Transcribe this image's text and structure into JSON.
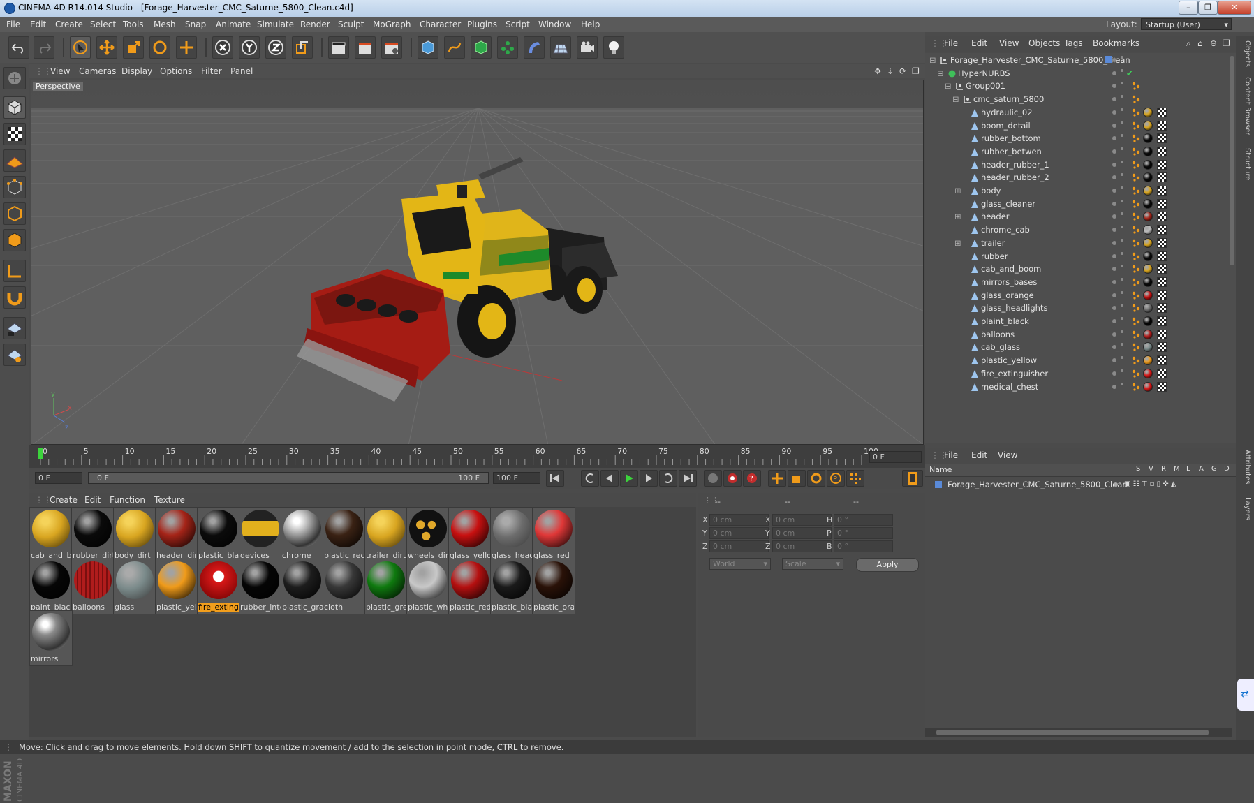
{
  "window": {
    "title": "CINEMA 4D R14.014 Studio - [Forage_Harvester_CMC_Saturne_5800_Clean.c4d]",
    "controls": [
      "–",
      "❐",
      "✕"
    ]
  },
  "menubar": {
    "items": [
      "File",
      "Edit",
      "Create",
      "Select",
      "Tools",
      "Mesh",
      "Snap",
      "Animate",
      "Simulate",
      "Render",
      "Sculpt",
      "MoGraph",
      "Character",
      "Plugins",
      "Script",
      "Window",
      "Help"
    ],
    "layout_label": "Layout:",
    "layout_value": "Startup (User)"
  },
  "viewport": {
    "menu": [
      "View",
      "Cameras",
      "Display",
      "Options",
      "Filter",
      "Panel"
    ],
    "label": "Perspective"
  },
  "timeline": {
    "ticks": [
      "0",
      "5",
      "10",
      "15",
      "20",
      "25",
      "30",
      "35",
      "40",
      "45",
      "50",
      "55",
      "60",
      "65",
      "70",
      "75",
      "80",
      "85",
      "90",
      "95",
      "100"
    ],
    "current_frame": "0 F",
    "start_field": "0 F",
    "range_start": "0 F",
    "range_end": "100 F",
    "end_field": "100 F"
  },
  "materials": {
    "menu": [
      "Create",
      "Edit",
      "Function",
      "Texture"
    ],
    "items": [
      {
        "label": "cab_and_b",
        "color": "#d8a520",
        "style": "yellow-dark"
      },
      {
        "label": "rubber_dirt",
        "color": "#0a0a0a",
        "style": "black"
      },
      {
        "label": "body_dirt_(",
        "color": "#d8a520",
        "style": "yellow-dark"
      },
      {
        "label": "header_dir",
        "color": "#a52418",
        "style": "red"
      },
      {
        "label": "plastic_blac",
        "color": "#0b0b0b",
        "style": "black"
      },
      {
        "label": "devices",
        "color": "#e2b01d",
        "style": "yellow-stripe"
      },
      {
        "label": "chrome",
        "color": "#b9b9b9",
        "style": "chrome"
      },
      {
        "label": "plastic_red",
        "color": "#3a2214",
        "style": "dark-brown"
      },
      {
        "label": "trailer_dirt",
        "color": "#d8a520",
        "style": "yellow-dark"
      },
      {
        "label": "wheels_dir",
        "color": "#e0a82a",
        "style": "yellow-dots"
      },
      {
        "label": "glass_yello",
        "color": "#c81010",
        "style": "red-glossy"
      },
      {
        "label": "glass_head",
        "color": "#6c6c6c",
        "style": "glass"
      },
      {
        "label": "glass_red",
        "color": "#e03838",
        "style": "red-glossy"
      },
      {
        "label": "paint_black",
        "color": "#060606",
        "style": "black"
      },
      {
        "label": "balloons",
        "color": "#b01c1c",
        "style": "red-lines"
      },
      {
        "label": "glass",
        "color": "#7a8a8a",
        "style": "glass"
      },
      {
        "label": "plastic_yell",
        "color": "#f09b1a",
        "style": "orange"
      },
      {
        "label": "fire_exting",
        "color": "#d81818",
        "style": "fire"
      },
      {
        "label": "rubber_inte",
        "color": "#050505",
        "style": "black"
      },
      {
        "label": "plastic_gra",
        "color": "#1d1d1d",
        "style": "dark"
      },
      {
        "label": "cloth",
        "color": "#383838",
        "style": "dark"
      },
      {
        "label": "plastic_gre",
        "color": "#0f7a0f",
        "style": "green"
      },
      {
        "label": "plastic_whi",
        "color": "#c8c8c8",
        "style": "white"
      },
      {
        "label": "plastic_red",
        "color": "#b51010",
        "style": "red-glossy"
      },
      {
        "label": "plastic_blac",
        "color": "#1a1a1a",
        "style": "dark"
      },
      {
        "label": "plastic_ora",
        "color": "#2a1208",
        "style": "dark-brown"
      },
      {
        "label": "mirrors",
        "color": "#8a8a8a",
        "style": "chrome"
      }
    ],
    "selected_index": 17
  },
  "coordinates": {
    "header": [
      "--",
      "--",
      "--"
    ],
    "rows": [
      {
        "a": "X",
        "av": "0 cm",
        "b": "X",
        "bv": "0 cm",
        "c": "H",
        "cv": "0 °"
      },
      {
        "a": "Y",
        "av": "0 cm",
        "b": "Y",
        "bv": "0 cm",
        "c": "P",
        "cv": "0 °"
      },
      {
        "a": "Z",
        "av": "0 cm",
        "b": "Z",
        "bv": "0 cm",
        "c": "B",
        "cv": "0 °"
      }
    ],
    "mode": "World",
    "transform": "Scale",
    "apply": "Apply"
  },
  "object_manager": {
    "menu": [
      "File",
      "Edit",
      "View",
      "Objects",
      "Tags",
      "Bookmarks"
    ],
    "objects": [
      {
        "name": "Forage_Harvester_CMC_Saturne_5800_Clean",
        "depth": 0,
        "kind": "null",
        "tag": "none"
      },
      {
        "name": "HyperNURBS",
        "depth": 1,
        "kind": "nurbs",
        "tag": "check"
      },
      {
        "name": "Group001",
        "depth": 2,
        "kind": "null",
        "tag": "orange"
      },
      {
        "name": "cmc_saturn_5800",
        "depth": 3,
        "kind": "null",
        "tag": "orange"
      },
      {
        "name": "hydraulic_02",
        "depth": 4,
        "kind": "poly",
        "tag": "mat",
        "ball": "#d8a520"
      },
      {
        "name": "boom_detail",
        "depth": 4,
        "kind": "poly",
        "tag": "mat",
        "ball": "#d8a520"
      },
      {
        "name": "rubber_bottom",
        "depth": 4,
        "kind": "poly",
        "tag": "mat",
        "ball": "#0a0a0a"
      },
      {
        "name": "rubber_betwen",
        "depth": 4,
        "kind": "poly",
        "tag": "mat",
        "ball": "#0a0a0a"
      },
      {
        "name": "header_rubber_1",
        "depth": 4,
        "kind": "poly",
        "tag": "mat",
        "ball": "#0a0a0a"
      },
      {
        "name": "header_rubber_2",
        "depth": 4,
        "kind": "poly",
        "tag": "mat",
        "ball": "#0a0a0a"
      },
      {
        "name": "body",
        "depth": 4,
        "kind": "poly",
        "tag": "mat",
        "ball": "#d8a520",
        "expand": true
      },
      {
        "name": "glass_cleaner",
        "depth": 4,
        "kind": "poly",
        "tag": "mat",
        "ball": "#0a0a0a"
      },
      {
        "name": "header",
        "depth": 4,
        "kind": "poly",
        "tag": "mat",
        "ball": "#a52418",
        "expand": true
      },
      {
        "name": "chrome_cab",
        "depth": 4,
        "kind": "poly",
        "tag": "mat",
        "ball": "#bbbbbb"
      },
      {
        "name": "trailer",
        "depth": 4,
        "kind": "poly",
        "tag": "mat",
        "ball": "#d8a520",
        "expand": true
      },
      {
        "name": "rubber",
        "depth": 4,
        "kind": "poly",
        "tag": "mat",
        "ball": "#0a0a0a"
      },
      {
        "name": "cab_and_boom",
        "depth": 4,
        "kind": "poly",
        "tag": "mat",
        "ball": "#d8a520"
      },
      {
        "name": "mirrors_bases",
        "depth": 4,
        "kind": "poly",
        "tag": "mat",
        "ball": "#0a0a0a"
      },
      {
        "name": "glass_orange",
        "depth": 4,
        "kind": "poly",
        "tag": "mat",
        "ball": "#c81010"
      },
      {
        "name": "glass_headlights",
        "depth": 4,
        "kind": "poly",
        "tag": "mat",
        "ball": "#6c6c6c"
      },
      {
        "name": "plaint_black",
        "depth": 4,
        "kind": "poly",
        "tag": "mat",
        "ball": "#060606"
      },
      {
        "name": "balloons",
        "depth": 4,
        "kind": "poly",
        "tag": "mat",
        "ball": "#b01c1c"
      },
      {
        "name": "cab_glass",
        "depth": 4,
        "kind": "poly",
        "tag": "mat",
        "ball": "#7a8a8a"
      },
      {
        "name": "plastic_yellow",
        "depth": 4,
        "kind": "poly",
        "tag": "mat",
        "ball": "#f09b1a"
      },
      {
        "name": "fire_extinguisher",
        "depth": 4,
        "kind": "poly",
        "tag": "mat",
        "ball": "#d81818"
      },
      {
        "name": "medical_chest",
        "depth": 4,
        "kind": "poly",
        "tag": "mat",
        "ball": "#d81818"
      }
    ]
  },
  "layer_manager": {
    "menu": [
      "File",
      "Edit",
      "View"
    ],
    "columns": [
      "Name",
      "S",
      "V",
      "R",
      "M",
      "L",
      "A",
      "G",
      "D"
    ],
    "row": "Forage_Harvester_CMC_Saturne_5800_Clean"
  },
  "right_tabs": [
    "Objects",
    "Content Browser",
    "Structure",
    "Attributes",
    "Layers"
  ],
  "status": {
    "text": "Move: Click and drag to move elements. Hold down SHIFT to quantize movement / add to the selection in point mode, CTRL to remove."
  },
  "brand": "MAXON CINEMA 4D"
}
